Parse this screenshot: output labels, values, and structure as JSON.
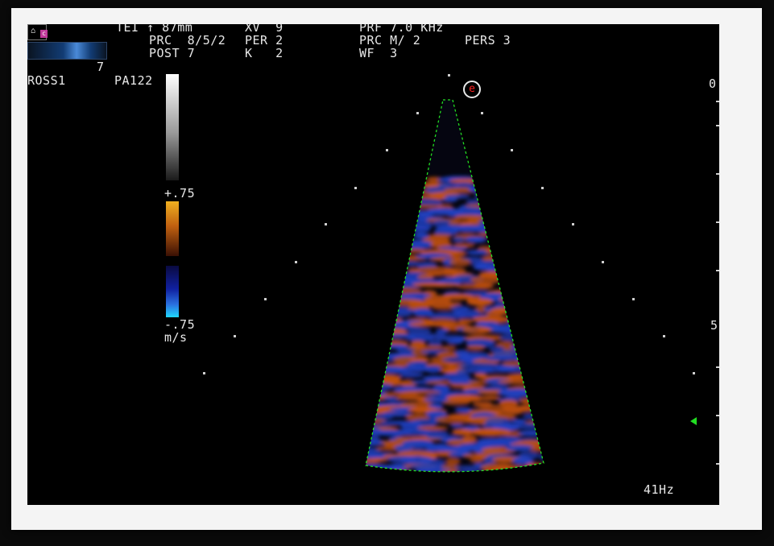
{
  "header": {
    "line1": "TEI ↑ 87mm",
    "line1b": "XV  9",
    "line1c": "PRF 7.0 KHz",
    "line2": "PRC  8/5/2",
    "line2b": "PER 2",
    "line2c": "PRC M/ 2",
    "line2d": "PERS 3",
    "line3": "POST 7",
    "line3b": "K   2",
    "line3c": "WF  3"
  },
  "left_labels": {
    "gain": "7",
    "patient": "ROSS1",
    "probe": "PA122"
  },
  "velocity_scale": {
    "max": "+.75",
    "min": "-.75",
    "unit": "m/s"
  },
  "depth_scale": {
    "top": "0",
    "mid": "5"
  },
  "frame_rate": "41Hz",
  "logo_letter": "c",
  "marker_letter": "e",
  "colors": {
    "sector_border": "#22dd22",
    "doppler_red": "#c05010",
    "doppler_blue": "#2040c0",
    "marker": "#22dd22"
  }
}
